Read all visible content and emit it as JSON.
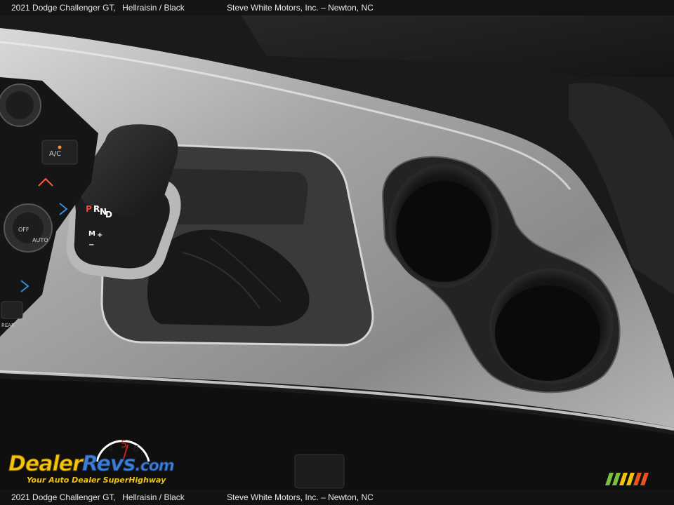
{
  "caption": {
    "vehicle": "2021 Dodge Challenger GT,",
    "color": "Hellraisin / Black",
    "dealer": "Steve White Motors, Inc.",
    "dash": "–",
    "location": "Newton, NC"
  },
  "logo": {
    "name_part1": "Dealer",
    "name_part2": "Revs",
    "suffix": ".com",
    "tagline": "Your Auto Dealer SuperHighway",
    "gauge_digits": [
      "4",
      "5",
      "6"
    ]
  },
  "shifter_labels": [
    "P",
    "R",
    "N",
    "D",
    "M",
    "+",
    "−"
  ],
  "climate_labels": [
    "A/C",
    "AUTO",
    "OFF",
    "REAR"
  ],
  "colors": {
    "brand_yellow": "#f2c40f",
    "brand_blue": "#3c7fd8",
    "trim_silver": "#9a9a9a"
  }
}
